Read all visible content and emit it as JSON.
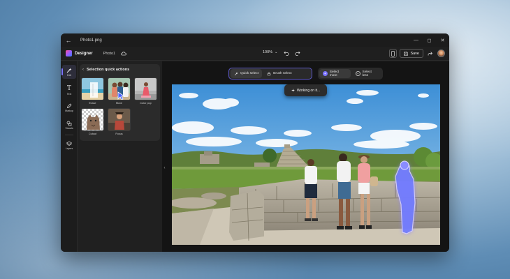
{
  "window": {
    "title": "Photo1.png"
  },
  "app": {
    "name": "Designer",
    "doc_name": "Photo1",
    "zoom": "100%",
    "save_label": "Save"
  },
  "rail": [
    {
      "label": "Edit",
      "icon": "magic-wand-icon"
    },
    {
      "label": "Text",
      "icon": "text-icon"
    },
    {
      "label": "Markup",
      "icon": "pen-icon"
    },
    {
      "label": "Visuals",
      "icon": "shapes-icon"
    },
    {
      "label": "Layers",
      "icon": "layers-icon"
    }
  ],
  "panel": {
    "title": "Selection quick actions",
    "actions": [
      {
        "label": "Erase"
      },
      {
        "label": "Move"
      },
      {
        "label": "Color pop"
      },
      {
        "label": "Cutout"
      },
      {
        "label": "Focus"
      }
    ]
  },
  "selection": {
    "quick_select": "Quick select",
    "brush_select": "Brush select",
    "select_more": "Select more",
    "select_less": "Select less"
  },
  "status": {
    "working": "Working on it..."
  },
  "colors": {
    "accent": "#7b74ff",
    "window_bg": "#202020",
    "panel_bg": "#2b2b2b",
    "selection_glow": "#8f7dff"
  }
}
